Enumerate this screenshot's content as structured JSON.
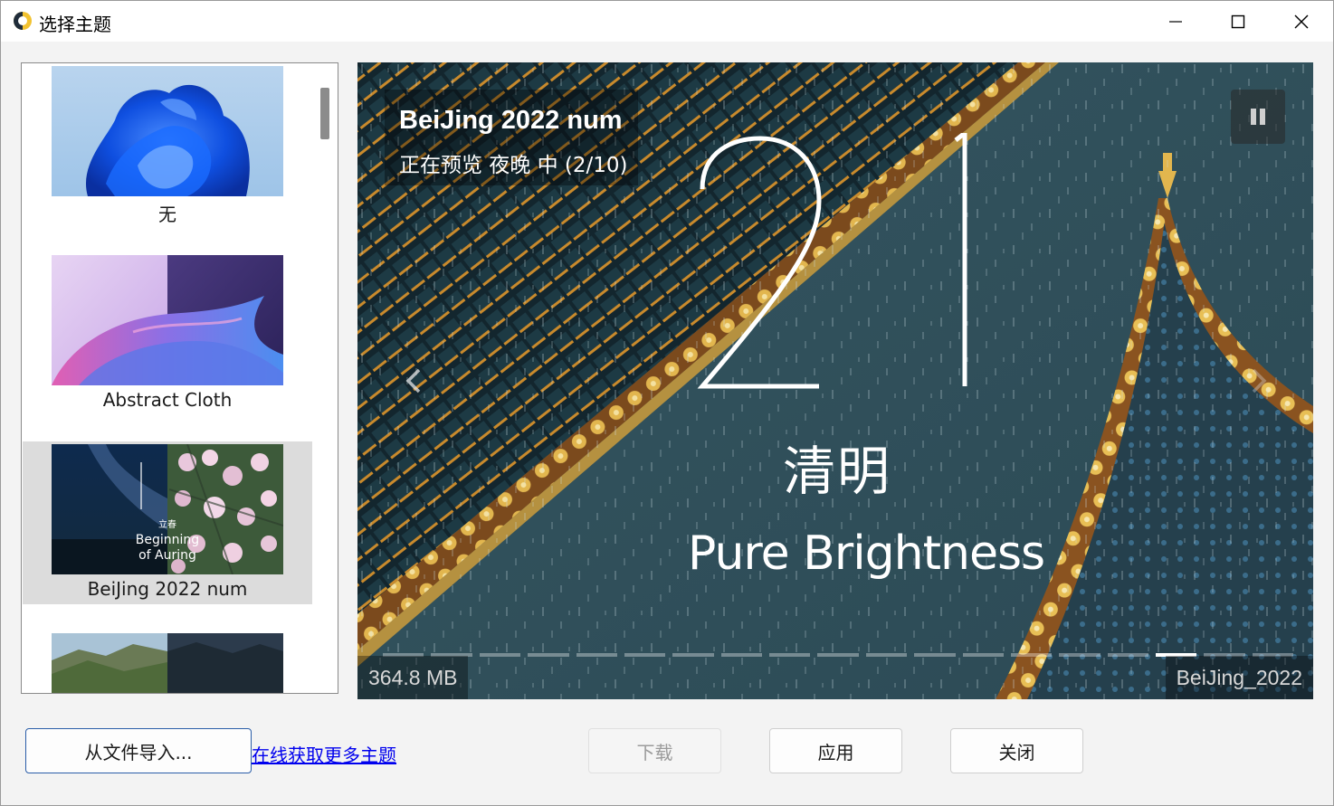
{
  "window": {
    "title": "选择主题"
  },
  "themes": [
    {
      "label": "无",
      "selected": false
    },
    {
      "label": "Abstract Cloth",
      "selected": false
    },
    {
      "label": "BeiJing 2022 num",
      "selected": true,
      "thumb_text_cn": "立春",
      "thumb_text_en1": "Beginning",
      "thumb_text_en2": "of Auring"
    },
    {
      "label": "",
      "selected": false
    }
  ],
  "preview": {
    "title": "BeiJing 2022 num",
    "status": "正在预览 夜晚 中 (2/10)",
    "overlay_cn": "清明",
    "overlay_en": "Pure Brightness",
    "size": "364.8 MB",
    "folder": "BeiJing_2022",
    "progress_segments": 19,
    "active_segment": 16
  },
  "buttons": {
    "import": "从文件导入...",
    "online_link": "在线获取更多主题",
    "download": "下载",
    "apply": "应用",
    "close": "关闭"
  },
  "colors": {
    "link": "#0000ee",
    "selected_bg": "#dcdcdc",
    "import_border": "#2a5da8"
  }
}
